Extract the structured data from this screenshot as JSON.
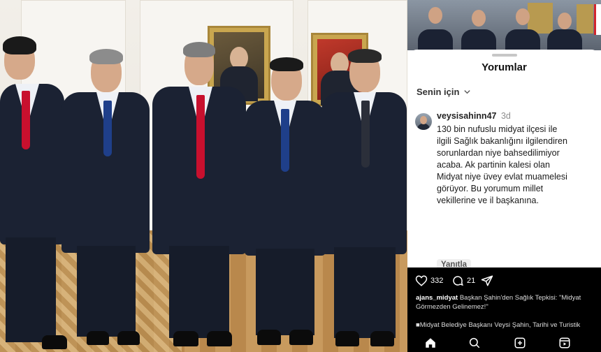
{
  "sheet": {
    "title": "Yorumlar",
    "sort_label": "Senin için"
  },
  "comment": {
    "username": "veysisahinn47",
    "time": "3d",
    "text": "130 bin nufuslu midyat ilçesi  ile\nilgili  Sağlık bakanlığını ilgilendiren\nsorunlardan niye bahsedilimiyor\nacaba. Ak partinin kalesi olan\nMidyat niye üvey evlat muamelesi\ngörüyor. Bu yorumum  millet\nvekillerine ve il başkanına.",
    "reply_label": "Yanıtla"
  },
  "post": {
    "likes": "332",
    "comments": "21",
    "caption_user": "ajans_midyat",
    "caption_line1": "Başkan Şahin'den Sağlık Tepkisi: \"Midyat",
    "caption_line2": "Görmezden Gelinemez!\"",
    "caption_more": "■Midyat Belediye Başkanı Veysi Şahin, Tarihi ve Turistik"
  },
  "icons": {
    "sort_chevron": "chevron-down-icon",
    "like": "heart-icon",
    "comment": "comment-icon",
    "share": "send-icon",
    "nav_home": "home-icon",
    "nav_search": "search-icon",
    "nav_create": "plus-square-icon",
    "nav_reels": "reels-icon"
  },
  "colors": {
    "suit": "#1b2233",
    "red_tie": "#c8102e",
    "blue_tie": "#1f3f8a",
    "ig_background": "#ffffff",
    "bar_background": "#000000"
  }
}
